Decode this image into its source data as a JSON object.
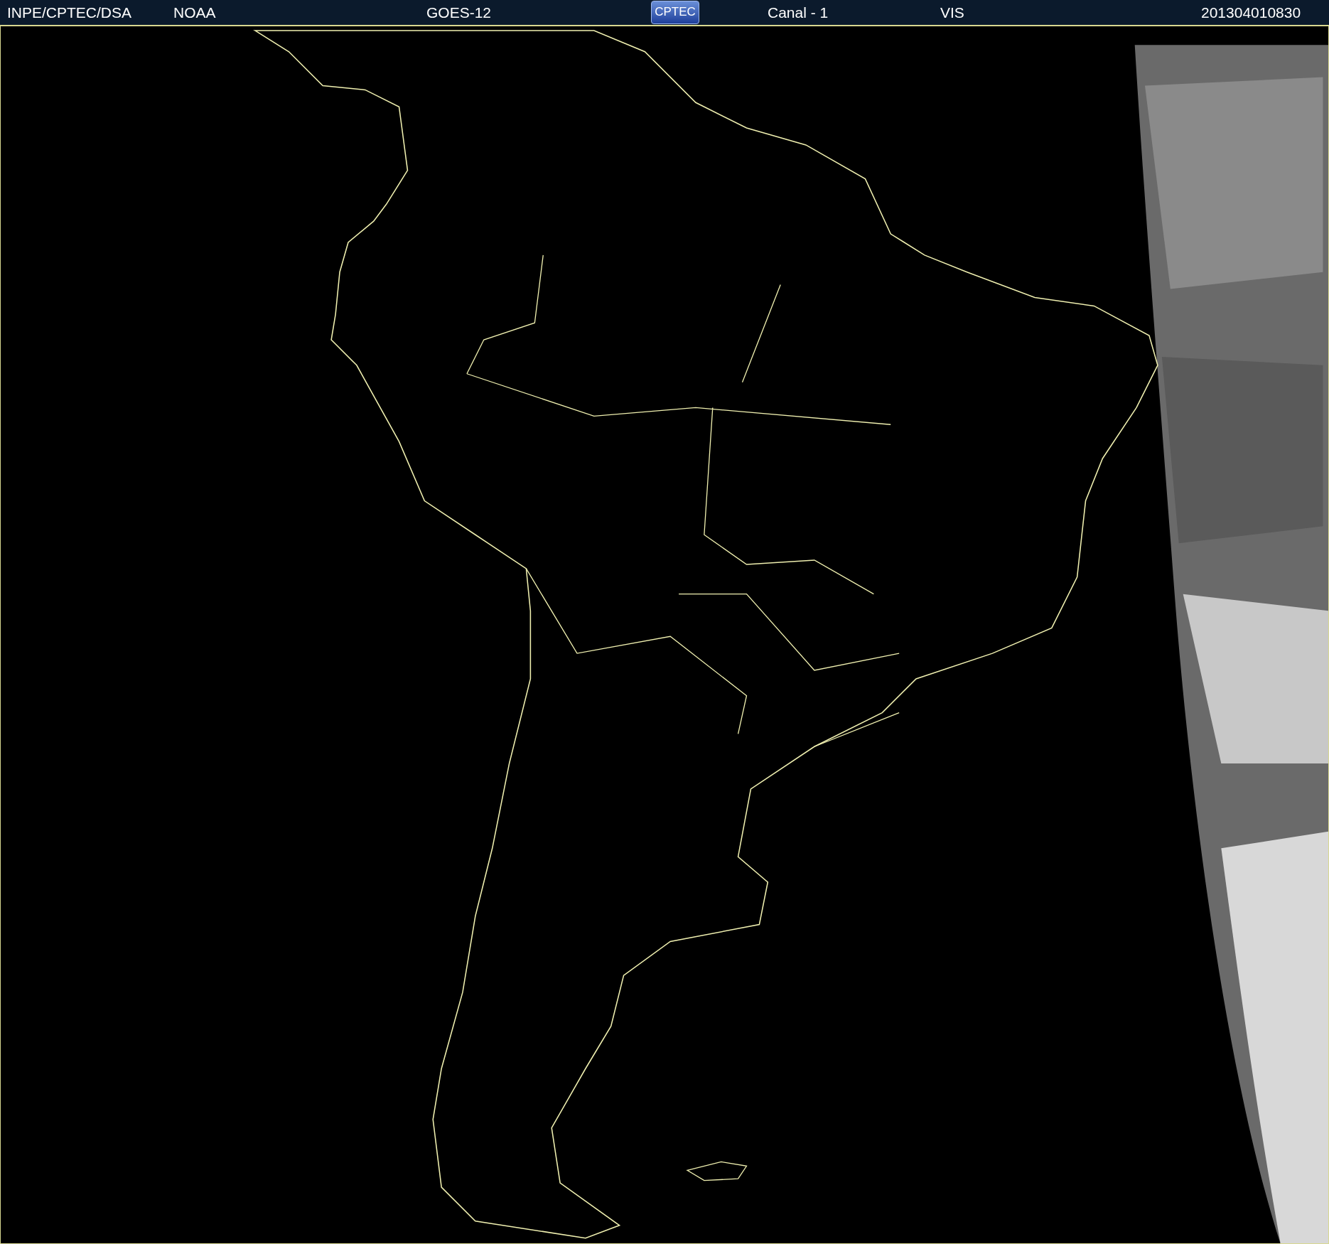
{
  "header": {
    "texts": [
      {
        "kind": "source",
        "text": "INPE/CPTEC/DSA"
      },
      {
        "kind": "agency",
        "text": "NOAA"
      },
      {
        "kind": "satellite",
        "text": "GOES-12"
      },
      {
        "kind": "logo",
        "text": "CPTEC"
      },
      {
        "kind": "channel",
        "text": "Canal - 1"
      },
      {
        "kind": "band",
        "text": "VIS"
      },
      {
        "kind": "timestamp",
        "text": "201304010830"
      }
    ]
  }
}
